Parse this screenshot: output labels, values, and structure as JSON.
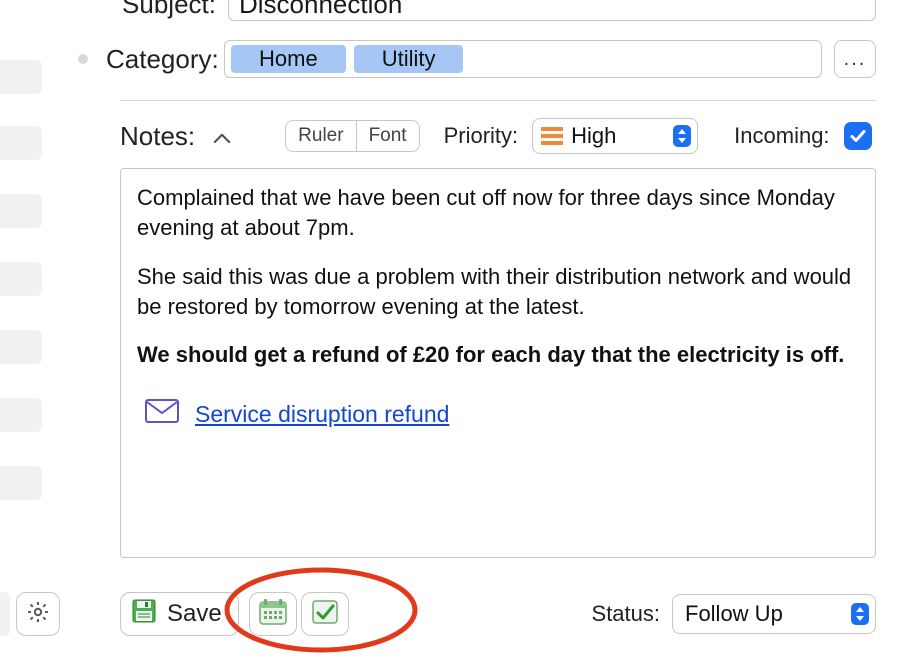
{
  "subject": {
    "label": "Subject:",
    "value": "Disconnection"
  },
  "category": {
    "label": "Category:",
    "tags": [
      "Home",
      "Utility"
    ],
    "more": "..."
  },
  "notes_header": {
    "label": "Notes:",
    "ruler": "Ruler",
    "font": "Font",
    "priority_label": "Priority:",
    "priority_value": "High",
    "incoming_label": "Incoming:",
    "incoming_checked": true
  },
  "notes_body": {
    "p1": "Complained that we have been cut off now for three days since Monday evening at about 7pm.",
    "p2": "She said this was due a problem with their distribution network and would be restored by tomorrow evening at the latest.",
    "p3": "We should get a refund of £20 for each day that the electricity is off.",
    "link_text": "Service disruption refund"
  },
  "bottom": {
    "save": "Save",
    "status_label": "Status:",
    "status_value": "Follow Up"
  }
}
